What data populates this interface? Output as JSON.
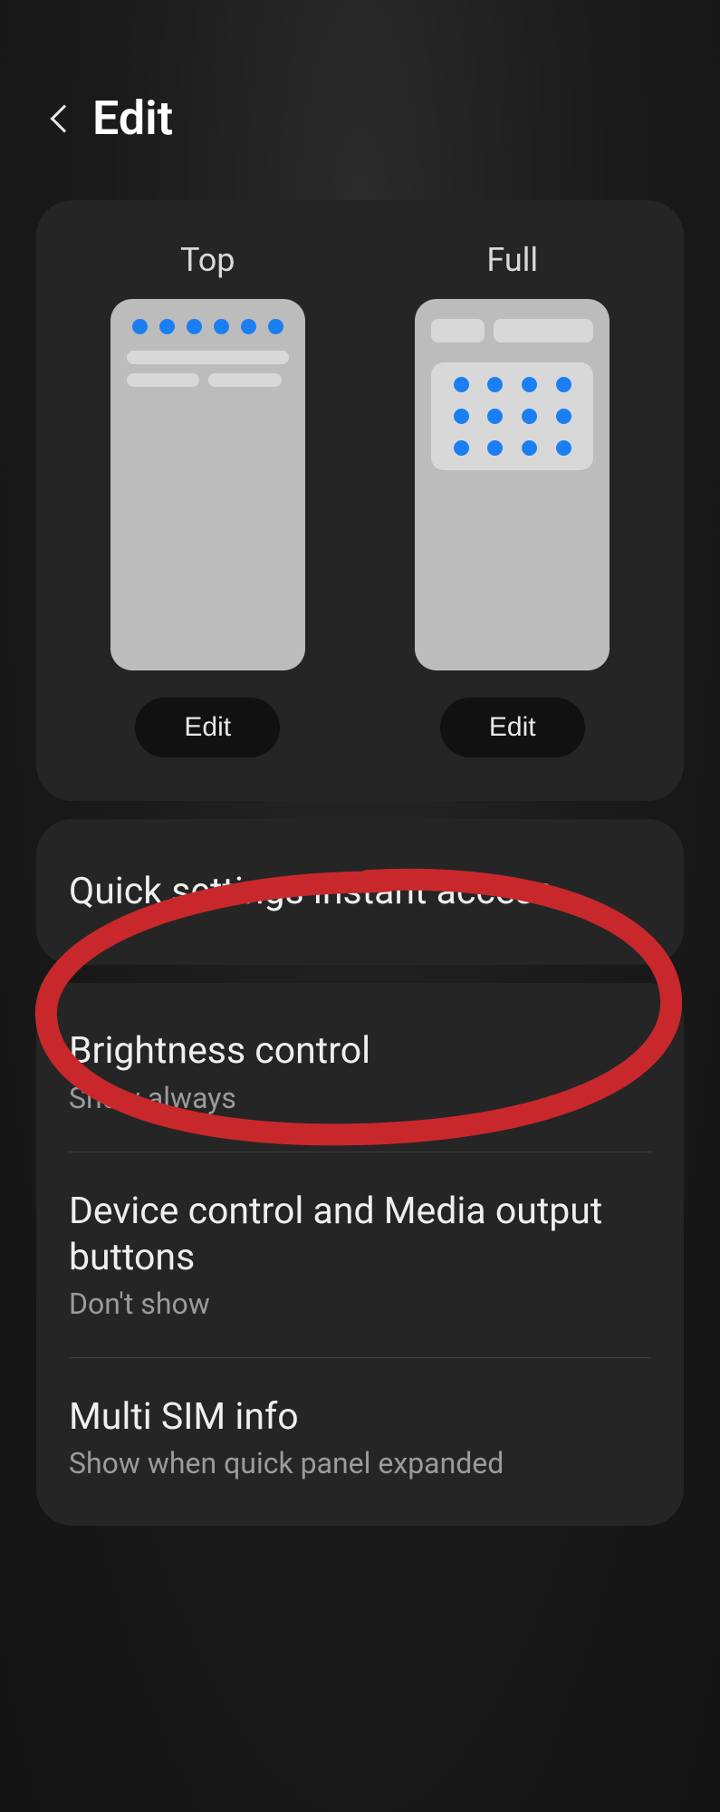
{
  "header": {
    "title": "Edit"
  },
  "previews": {
    "top_label": "Top",
    "full_label": "Full",
    "edit_button_label": "Edit"
  },
  "settings": [
    {
      "title": "Quick settings instant access",
      "annotated": true
    },
    {
      "title": "Brightness control",
      "sub": "Show always"
    },
    {
      "title": "Device control and Media output buttons",
      "sub": "Don't show"
    },
    {
      "title": "Multi SIM info",
      "sub": "Show when quick panel expanded"
    }
  ],
  "colors": {
    "accent_blue": "#1a7ff3",
    "annotation_red": "#c8282c"
  }
}
